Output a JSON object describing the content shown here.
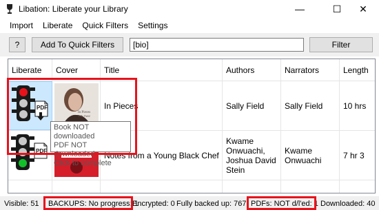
{
  "window": {
    "title": "Libation: Liberate your Library",
    "minimize_glyph": "—",
    "maximize_glyph": "☐",
    "close_glyph": "✕"
  },
  "menu": [
    "Import",
    "Liberate",
    "Quick Filters",
    "Settings"
  ],
  "toolbar": {
    "help_label": "?",
    "add_quick_filter_label": "Add To Quick Filters",
    "filter_value": "[bio]",
    "filter_button_label": "Filter"
  },
  "grid": {
    "columns": [
      "Liberate",
      "Cover",
      "Title",
      "Authors",
      "Narrators",
      "Length"
    ],
    "rows": [
      {
        "title": "In Pieces",
        "authors": "Sally Field",
        "narrators": "Sally Field",
        "length": "10 hrs",
        "cover_text": "In Pieces",
        "cover_author": "Sally Field",
        "status": "book-not-downloaded, pdf-not-downloaded"
      },
      {
        "title": "Notes from a Young Black Chef",
        "authors": "Kwame Onwuachi, Joshua David Stein",
        "narrators": "Kwame Onwuachi",
        "length": "7 hr 3",
        "status": "pdf-not-downloaded"
      }
    ]
  },
  "tooltip": {
    "line1": "Book NOT downloaded",
    "line2": "PDF NOT downloaded",
    "line3": "Click to complete"
  },
  "status_bar": {
    "visible": "Visible: 51",
    "backups": "BACKUPS: No progress: 1",
    "encrypted": "Encrypted: 0",
    "fully_backed_up": "Fully backed up: 767",
    "pdfs": "PDFs: NOT d/l'ed: 1",
    "downloaded": "Downloaded: 40"
  },
  "colors": {
    "highlight_red": "#e8121b",
    "selection_blue": "#cce8ff",
    "traffic_red": "#e8121b",
    "traffic_green": "#12c02a"
  }
}
